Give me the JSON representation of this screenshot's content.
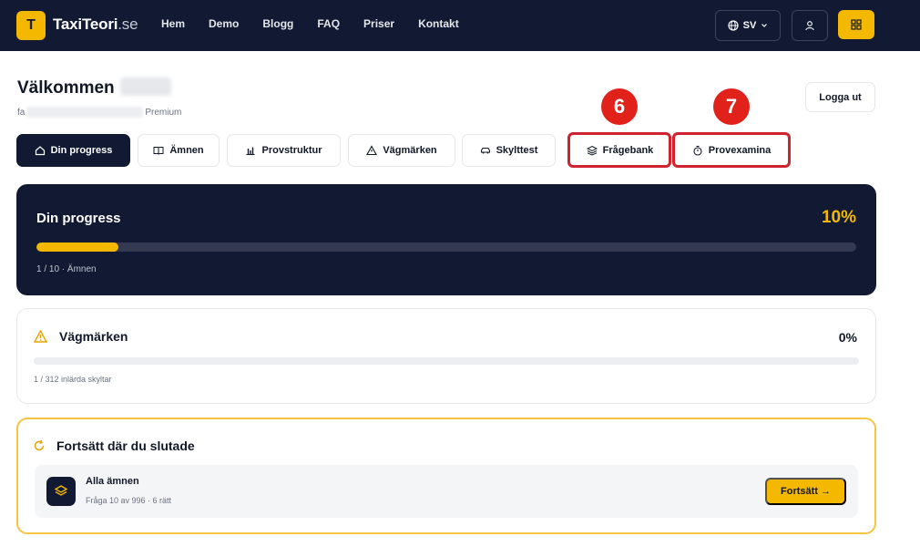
{
  "header": {
    "logo_letter": "T",
    "brand": "TaxiTeori",
    "brand_suffix": ".se",
    "nav": [
      "Hem",
      "Demo",
      "Blogg",
      "FAQ",
      "Priser",
      "Kontakt"
    ],
    "language": "SV"
  },
  "welcome": {
    "greeting": "Välkommen",
    "email_prefix": "fa",
    "plan": "Premium",
    "logout_label": "Logga ut"
  },
  "tabs": [
    {
      "label": "Din progress",
      "icon": "home-icon",
      "active": true
    },
    {
      "label": "Ämnen",
      "icon": "book-icon",
      "active": false
    },
    {
      "label": "Provstruktur",
      "icon": "bar-chart-icon",
      "active": false
    },
    {
      "label": "Vägmärken",
      "icon": "warning-icon",
      "active": false
    },
    {
      "label": "Skylttest",
      "icon": "car-icon",
      "active": false
    },
    {
      "label": "Frågebank",
      "icon": "layers-icon",
      "active": false
    },
    {
      "label": "Provexamina",
      "icon": "stopwatch-icon",
      "active": false
    }
  ],
  "annotations": [
    {
      "number": "6",
      "target": "Frågebank"
    },
    {
      "number": "7",
      "target": "Provexamina"
    }
  ],
  "progress": {
    "title": "Din progress",
    "percent_label": "10%",
    "fraction": 0.1,
    "count_text": "1 / 10 · Ämnen"
  },
  "signs": {
    "title": "Vägmärken",
    "percent_label": "0%",
    "fraction": 0,
    "count_text": "1 / 312 inlärda skyltar"
  },
  "continue": {
    "title": "Fortsätt där du slutade",
    "item_name": "Alla ämnen",
    "item_meta": "Fråga 10 av 996 · 6 rätt",
    "button_label": "Fortsätt →"
  },
  "colors": {
    "navy": "#111933",
    "accent": "#f5b800",
    "annotation_red": "#e0221b"
  }
}
